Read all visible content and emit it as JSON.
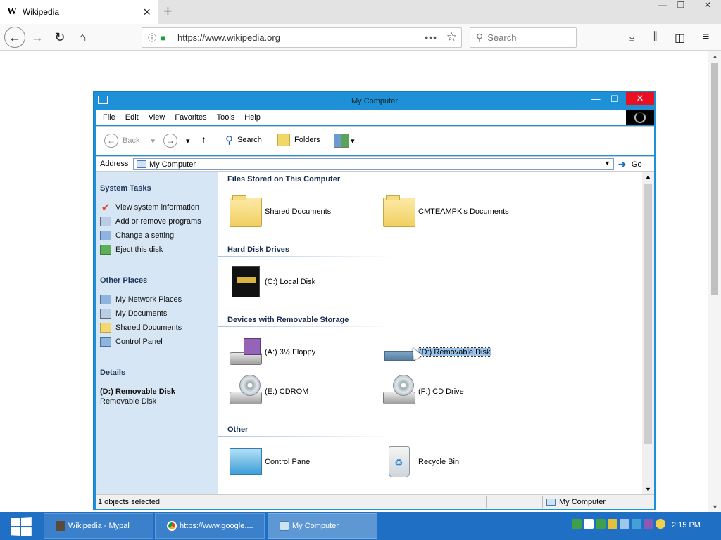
{
  "browser": {
    "tab_title": "Wikipedia",
    "tab_favicon": "W",
    "url": "https://www.wikipedia.org",
    "search_placeholder": "Search"
  },
  "explorer": {
    "window_title": "My Computer",
    "menu": [
      "File",
      "Edit",
      "View",
      "Favorites",
      "Tools",
      "Help"
    ],
    "toolbar": {
      "back": "Back",
      "search": "Search",
      "folders": "Folders"
    },
    "address": {
      "label": "Address",
      "value": "My Computer",
      "go": "Go"
    },
    "left_panel": {
      "system_tasks": {
        "heading": "System Tasks",
        "items": [
          "View system information",
          "Add or remove programs",
          "Change a setting",
          "Eject this disk"
        ]
      },
      "other_places": {
        "heading": "Other Places",
        "items": [
          "My Network Places",
          "My Documents",
          "Shared Documents",
          "Control Panel"
        ]
      },
      "details": {
        "heading": "Details",
        "name": "(D:) Removable Disk",
        "type": "Removable Disk"
      }
    },
    "groups": {
      "files": {
        "heading": "Files Stored on This Computer",
        "items": [
          "Shared Documents",
          "CMTEAMPK's Documents"
        ]
      },
      "hdd": {
        "heading": "Hard Disk Drives",
        "items": [
          "(C:) Local Disk"
        ]
      },
      "removable": {
        "heading": "Devices with Removable Storage",
        "items": [
          "(A:) 3½ Floppy",
          "(D:) Removable Disk",
          "(E:) CDROM",
          "(F:) CD Drive"
        ],
        "selected": "(D:) Removable Disk"
      },
      "other": {
        "heading": "Other",
        "items": [
          "Control Panel",
          "Recycle Bin"
        ]
      }
    },
    "status": {
      "left": "1 objects selected",
      "right": "My Computer"
    }
  },
  "taskbar": {
    "tasks": [
      "Wikipedia - Mypal",
      "https://www.google....",
      "My Computer"
    ],
    "active_task": "My Computer",
    "clock": "2:15 PM"
  }
}
